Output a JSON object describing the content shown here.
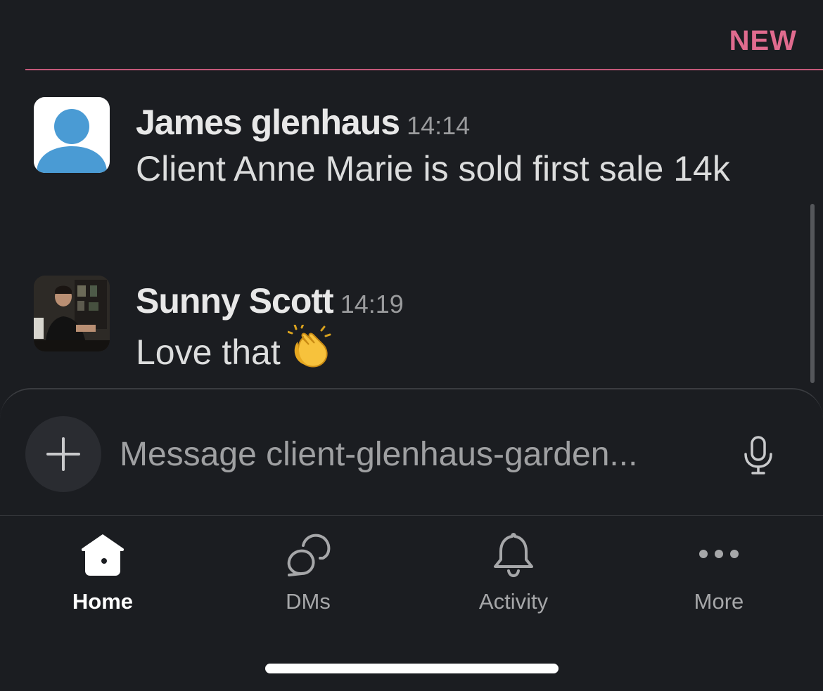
{
  "divider": {
    "label": "NEW"
  },
  "messages": [
    {
      "author": "James glenhaus",
      "time": "14:14",
      "text": "Client Anne Marie is sold first sale 14k",
      "avatar": "default-user-avatar"
    },
    {
      "author": "Sunny Scott",
      "time": "14:19",
      "text": "Love that",
      "emoji": "clapping-hands",
      "avatar": "photo-avatar"
    }
  ],
  "composer": {
    "placeholder": "Message client-glenhaus-garden...",
    "add_icon": "plus-icon",
    "mic_icon": "microphone-icon"
  },
  "tabs": [
    {
      "label": "Home",
      "icon": "home-icon",
      "active": true
    },
    {
      "label": "DMs",
      "icon": "dms-icon",
      "active": false
    },
    {
      "label": "Activity",
      "icon": "bell-icon",
      "active": false
    },
    {
      "label": "More",
      "icon": "more-icon",
      "active": false
    }
  ],
  "colors": {
    "background": "#1b1d21",
    "new_accent": "#e06b8e",
    "avatar_blue": "#4a9bd4"
  }
}
